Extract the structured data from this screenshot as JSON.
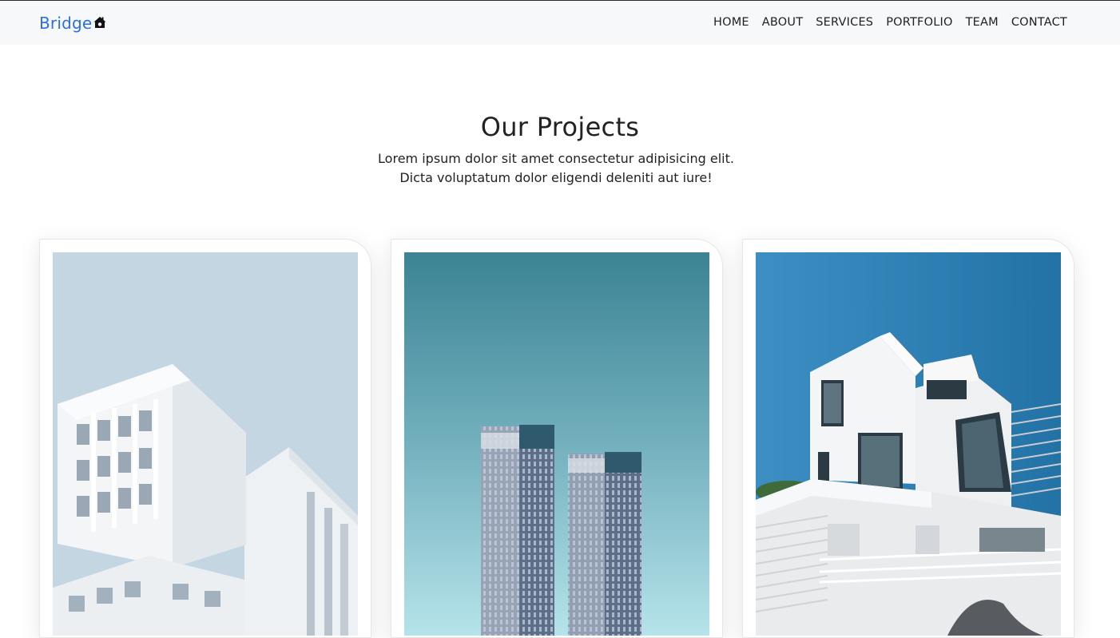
{
  "nav": {
    "brand": "Bridge",
    "brand_icon": "house-icon",
    "brand_color": "#2c6ee6",
    "links": [
      "HOME",
      "ABOUT",
      "SERVICES",
      "PORTFOLIO",
      "TEAM",
      "CONTACT"
    ]
  },
  "projects": {
    "title": "Our Projects",
    "subtitle_line1": "Lorem ipsum dolor sit amet consectetur adipisicing elit.",
    "subtitle_line2": "Dicta voluptatum dolor eligendi deleniti aut iure!",
    "cards": [
      {
        "image": "white-modular-building-photo"
      },
      {
        "image": "twin-skyscrapers-photo"
      },
      {
        "image": "modern-white-villa-photo"
      }
    ]
  }
}
